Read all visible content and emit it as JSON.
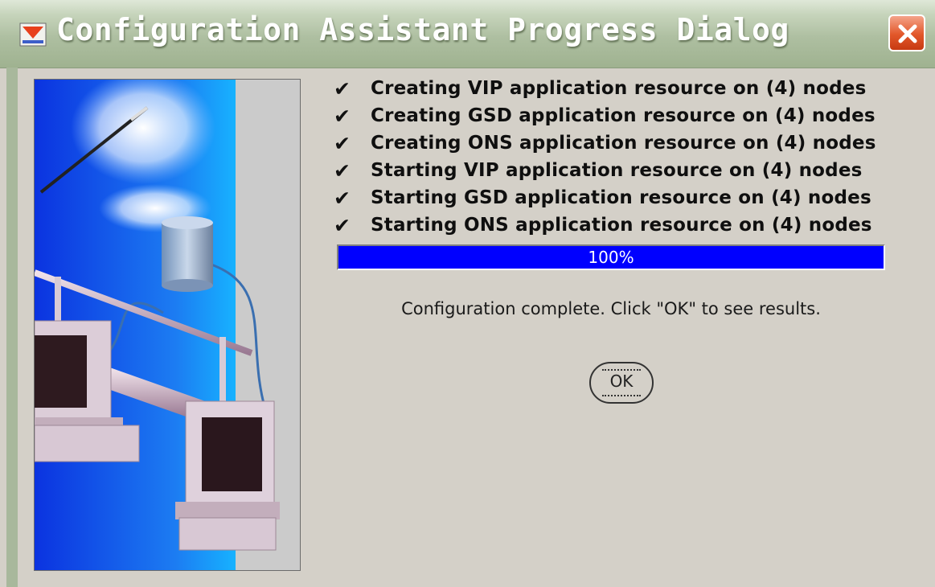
{
  "window": {
    "title": "Configuration Assistant Progress Dialog",
    "title_icon": "oracle-red-icon",
    "close_icon": "close-icon",
    "colors": {
      "title_bar": "#aebfa1",
      "close": "#e2572a",
      "progress_fill": "#0000ff",
      "background": "#d4d0c8"
    }
  },
  "checklist": {
    "check_symbol": "✔",
    "items": [
      "Creating VIP application resource on (4) nodes",
      "Creating GSD application resource on (4) nodes",
      "Creating ONS application resource on (4) nodes",
      "Starting VIP application resource on (4) nodes",
      "Starting GSD application resource on (4) nodes",
      "Starting ONS application resource on (4) nodes"
    ]
  },
  "progress": {
    "value": 100,
    "label": "100%"
  },
  "status_text": "Configuration complete. Click \"OK\" to see results.",
  "ok_button": {
    "label": "OK"
  }
}
